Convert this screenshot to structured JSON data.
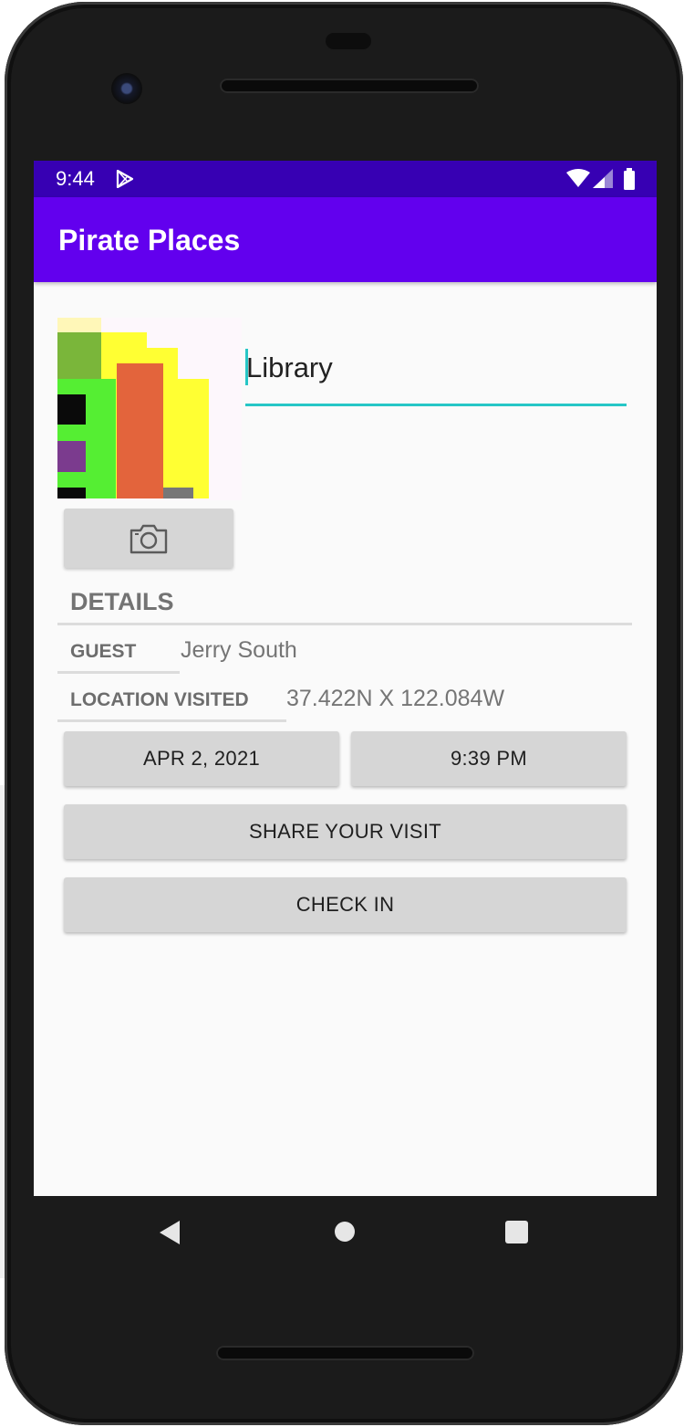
{
  "status_bar": {
    "time": "9:44"
  },
  "app_bar": {
    "title": "Pirate Places"
  },
  "place": {
    "title_value": "Library"
  },
  "details": {
    "section_label": "DETAILS",
    "guest_label": "GUEST",
    "guest_value": "Jerry South",
    "location_label": "LOCATION VISITED",
    "location_value": "37.422N X 122.084W"
  },
  "buttons": {
    "date": "APR 2, 2021",
    "time": "9:39 PM",
    "share": "SHARE YOUR VISIT",
    "check_in": "CHECK IN"
  },
  "colors": {
    "status_bar": "#3700b3",
    "app_bar": "#6200ee",
    "accent": "#26c6c6",
    "button": "#d6d6d6"
  },
  "icons": [
    "play-store-icon",
    "wifi-icon",
    "signal-icon",
    "battery-icon",
    "camera-icon",
    "back-icon",
    "home-icon",
    "recent-apps-icon"
  ]
}
